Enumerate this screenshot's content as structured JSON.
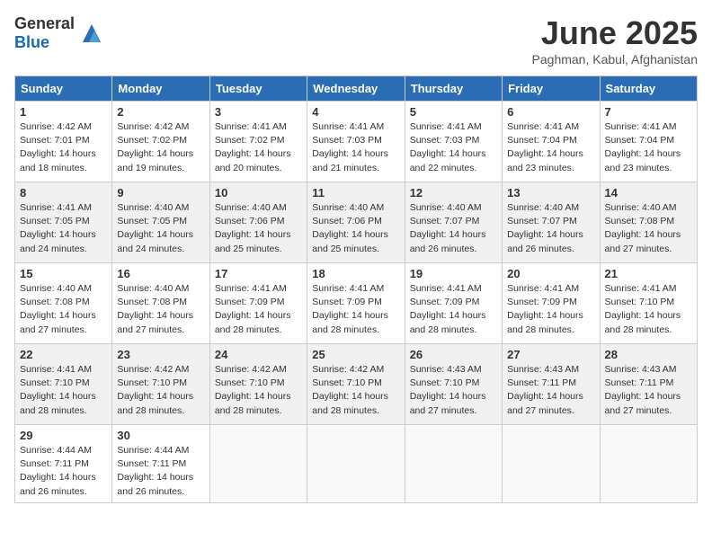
{
  "header": {
    "logo_general": "General",
    "logo_blue": "Blue",
    "month_title": "June 2025",
    "location": "Paghman, Kabul, Afghanistan"
  },
  "calendar": {
    "days_of_week": [
      "Sunday",
      "Monday",
      "Tuesday",
      "Wednesday",
      "Thursday",
      "Friday",
      "Saturday"
    ],
    "weeks": [
      [
        {
          "day": "1",
          "info": "Sunrise: 4:42 AM\nSunset: 7:01 PM\nDaylight: 14 hours\nand 18 minutes."
        },
        {
          "day": "2",
          "info": "Sunrise: 4:42 AM\nSunset: 7:02 PM\nDaylight: 14 hours\nand 19 minutes."
        },
        {
          "day": "3",
          "info": "Sunrise: 4:41 AM\nSunset: 7:02 PM\nDaylight: 14 hours\nand 20 minutes."
        },
        {
          "day": "4",
          "info": "Sunrise: 4:41 AM\nSunset: 7:03 PM\nDaylight: 14 hours\nand 21 minutes."
        },
        {
          "day": "5",
          "info": "Sunrise: 4:41 AM\nSunset: 7:03 PM\nDaylight: 14 hours\nand 22 minutes."
        },
        {
          "day": "6",
          "info": "Sunrise: 4:41 AM\nSunset: 7:04 PM\nDaylight: 14 hours\nand 23 minutes."
        },
        {
          "day": "7",
          "info": "Sunrise: 4:41 AM\nSunset: 7:04 PM\nDaylight: 14 hours\nand 23 minutes."
        }
      ],
      [
        {
          "day": "8",
          "info": "Sunrise: 4:41 AM\nSunset: 7:05 PM\nDaylight: 14 hours\nand 24 minutes."
        },
        {
          "day": "9",
          "info": "Sunrise: 4:40 AM\nSunset: 7:05 PM\nDaylight: 14 hours\nand 24 minutes."
        },
        {
          "day": "10",
          "info": "Sunrise: 4:40 AM\nSunset: 7:06 PM\nDaylight: 14 hours\nand 25 minutes."
        },
        {
          "day": "11",
          "info": "Sunrise: 4:40 AM\nSunset: 7:06 PM\nDaylight: 14 hours\nand 25 minutes."
        },
        {
          "day": "12",
          "info": "Sunrise: 4:40 AM\nSunset: 7:07 PM\nDaylight: 14 hours\nand 26 minutes."
        },
        {
          "day": "13",
          "info": "Sunrise: 4:40 AM\nSunset: 7:07 PM\nDaylight: 14 hours\nand 26 minutes."
        },
        {
          "day": "14",
          "info": "Sunrise: 4:40 AM\nSunset: 7:08 PM\nDaylight: 14 hours\nand 27 minutes."
        }
      ],
      [
        {
          "day": "15",
          "info": "Sunrise: 4:40 AM\nSunset: 7:08 PM\nDaylight: 14 hours\nand 27 minutes."
        },
        {
          "day": "16",
          "info": "Sunrise: 4:40 AM\nSunset: 7:08 PM\nDaylight: 14 hours\nand 27 minutes."
        },
        {
          "day": "17",
          "info": "Sunrise: 4:41 AM\nSunset: 7:09 PM\nDaylight: 14 hours\nand 28 minutes."
        },
        {
          "day": "18",
          "info": "Sunrise: 4:41 AM\nSunset: 7:09 PM\nDaylight: 14 hours\nand 28 minutes."
        },
        {
          "day": "19",
          "info": "Sunrise: 4:41 AM\nSunset: 7:09 PM\nDaylight: 14 hours\nand 28 minutes."
        },
        {
          "day": "20",
          "info": "Sunrise: 4:41 AM\nSunset: 7:09 PM\nDaylight: 14 hours\nand 28 minutes."
        },
        {
          "day": "21",
          "info": "Sunrise: 4:41 AM\nSunset: 7:10 PM\nDaylight: 14 hours\nand 28 minutes."
        }
      ],
      [
        {
          "day": "22",
          "info": "Sunrise: 4:41 AM\nSunset: 7:10 PM\nDaylight: 14 hours\nand 28 minutes."
        },
        {
          "day": "23",
          "info": "Sunrise: 4:42 AM\nSunset: 7:10 PM\nDaylight: 14 hours\nand 28 minutes."
        },
        {
          "day": "24",
          "info": "Sunrise: 4:42 AM\nSunset: 7:10 PM\nDaylight: 14 hours\nand 28 minutes."
        },
        {
          "day": "25",
          "info": "Sunrise: 4:42 AM\nSunset: 7:10 PM\nDaylight: 14 hours\nand 28 minutes."
        },
        {
          "day": "26",
          "info": "Sunrise: 4:43 AM\nSunset: 7:10 PM\nDaylight: 14 hours\nand 27 minutes."
        },
        {
          "day": "27",
          "info": "Sunrise: 4:43 AM\nSunset: 7:11 PM\nDaylight: 14 hours\nand 27 minutes."
        },
        {
          "day": "28",
          "info": "Sunrise: 4:43 AM\nSunset: 7:11 PM\nDaylight: 14 hours\nand 27 minutes."
        }
      ],
      [
        {
          "day": "29",
          "info": "Sunrise: 4:44 AM\nSunset: 7:11 PM\nDaylight: 14 hours\nand 26 minutes."
        },
        {
          "day": "30",
          "info": "Sunrise: 4:44 AM\nSunset: 7:11 PM\nDaylight: 14 hours\nand 26 minutes."
        },
        {
          "day": "",
          "info": ""
        },
        {
          "day": "",
          "info": ""
        },
        {
          "day": "",
          "info": ""
        },
        {
          "day": "",
          "info": ""
        },
        {
          "day": "",
          "info": ""
        }
      ]
    ]
  }
}
